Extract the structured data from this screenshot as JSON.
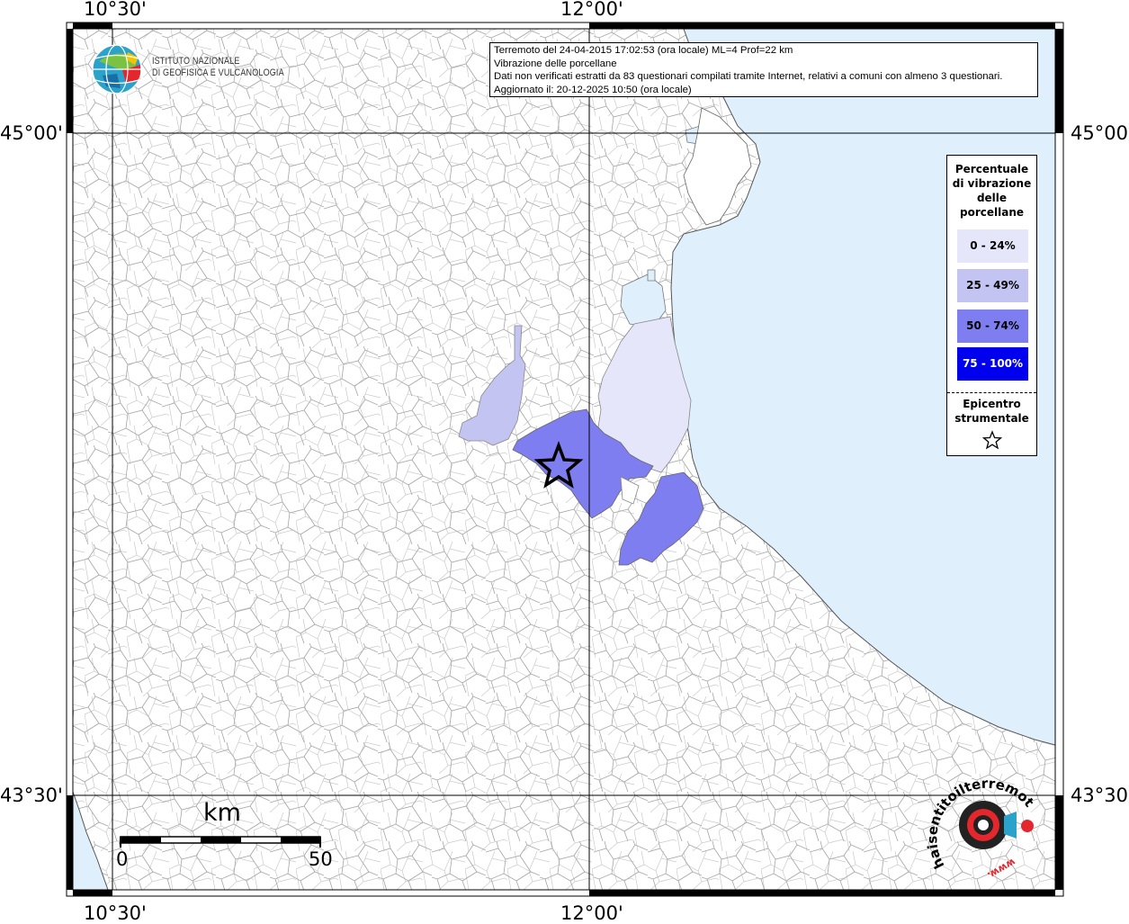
{
  "info": {
    "line1": "Terremoto del 24-04-2015 17:02:53 (ora locale) ML=4 Prof=22 km",
    "line2": "Vibrazione delle porcellane",
    "line3": "Dati non verificati estratti da 83 questionari compilati tramite Internet, relativi a comuni con almeno 3 questionari.",
    "line4": "Aggiornato il: 20-12-2025 10:50 (ora locale)"
  },
  "logo": {
    "line1": "ISTITUTO NAZIONALE",
    "line2": "DI GEOFISICA E VULCANOLOGIA"
  },
  "coords": {
    "lon_left": "10°30'",
    "lon_right": "12°00'",
    "lat_top": "45°00'",
    "lat_bottom": "43°30'"
  },
  "legend": {
    "title_lines": [
      "Percentuale",
      "di vibrazione",
      "delle",
      "porcellane"
    ],
    "items": [
      {
        "label": "0 - 24%",
        "color": "#e6e6fa",
        "text_color": "#000000"
      },
      {
        "label": "25 - 49%",
        "color": "#c4c4f2",
        "text_color": "#000000"
      },
      {
        "label": "50 - 74%",
        "color": "#7e7ef0",
        "text_color": "#000000"
      },
      {
        "label": "75 - 100%",
        "color": "#0000ee",
        "text_color": "#ffffff"
      }
    ],
    "epicenter_line1": "Epicentro",
    "epicenter_line2": "strumentale",
    "epicenter_icon": "star-icon"
  },
  "scale": {
    "unit": "km",
    "start": "0",
    "end": "50"
  },
  "watermark": {
    "text": "haisentitoilterremoto.it",
    "www": "www.",
    "icon": "target-icon"
  },
  "colors": {
    "sea": "#dff0fc",
    "land": "#ffffff",
    "borders": "#9a9a9a",
    "grid": "#000000"
  }
}
